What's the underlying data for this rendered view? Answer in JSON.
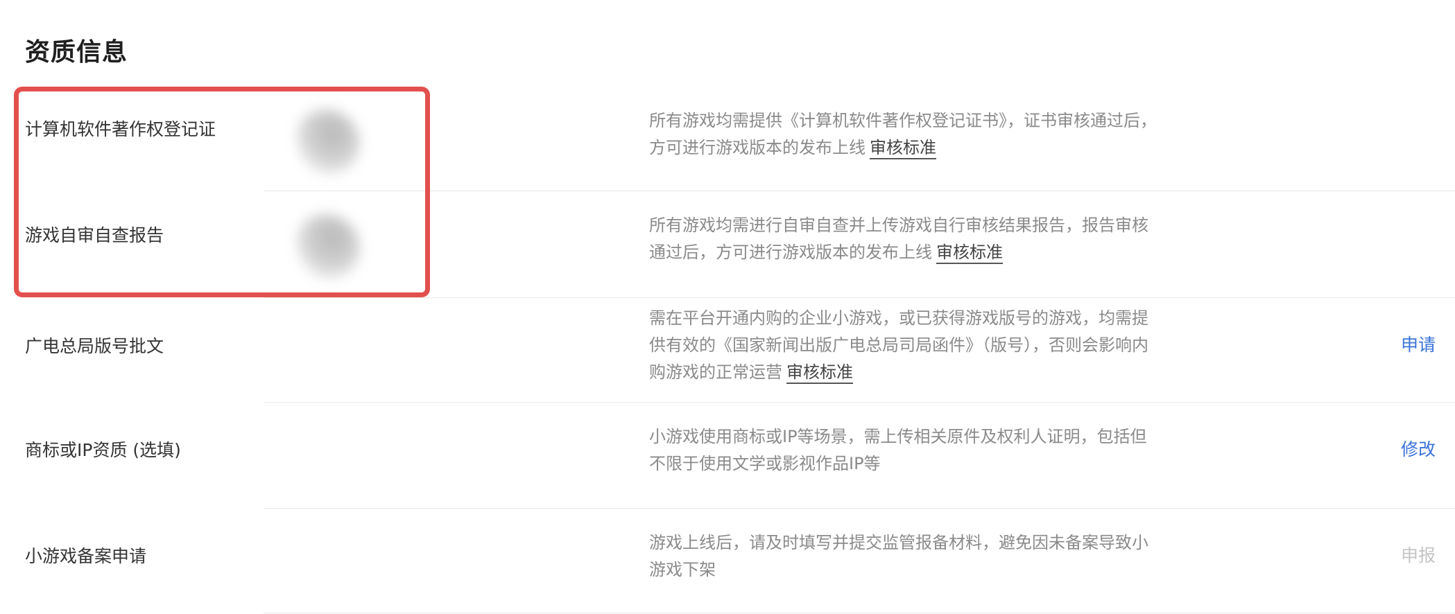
{
  "section": {
    "title": "资质信息"
  },
  "rows": [
    {
      "label": "计算机软件著作权登记证",
      "has_preview": true,
      "description": "所有游戏均需提供《计算机软件著作权登记证书》，证书审核通过后，方可进行游戏版本的发布上线",
      "link": "审核标准",
      "action": ""
    },
    {
      "label": "游戏自审自查报告",
      "has_preview": true,
      "description": "所有游戏均需进行自审自查并上传游戏自行审核结果报告，报告审核通过后，方可进行游戏版本的发布上线",
      "link": "审核标准",
      "action": ""
    },
    {
      "label": "广电总局版号批文",
      "has_preview": false,
      "description": "需在平台开通内购的企业小游戏，或已获得游戏版号的游戏，均需提供有效的《国家新闻出版广电总局司局函件》（版号），否则会影响内购游戏的正常运营",
      "link": "审核标准",
      "action": "申请",
      "action_state": "active"
    },
    {
      "label": "商标或IP资质 (选填)",
      "has_preview": false,
      "description": "小游戏使用商标或IP等场景，需上传相关原件及权利人证明，包括但不限于使用文学或影视作品IP等",
      "link": "",
      "action": "修改",
      "action_state": "active"
    },
    {
      "label": "小游戏备案申请",
      "has_preview": false,
      "description": "游戏上线后，请及时填写并提交监管报备材料，避免因未备案导致小游戏下架",
      "link": "",
      "action": "申报",
      "action_state": "disabled"
    }
  ],
  "colors": {
    "link_blue": "#3a73d9",
    "disabled_gray": "#c4c4c4",
    "highlight_red": "#e2504d",
    "description_gray": "#8a8a8a"
  }
}
